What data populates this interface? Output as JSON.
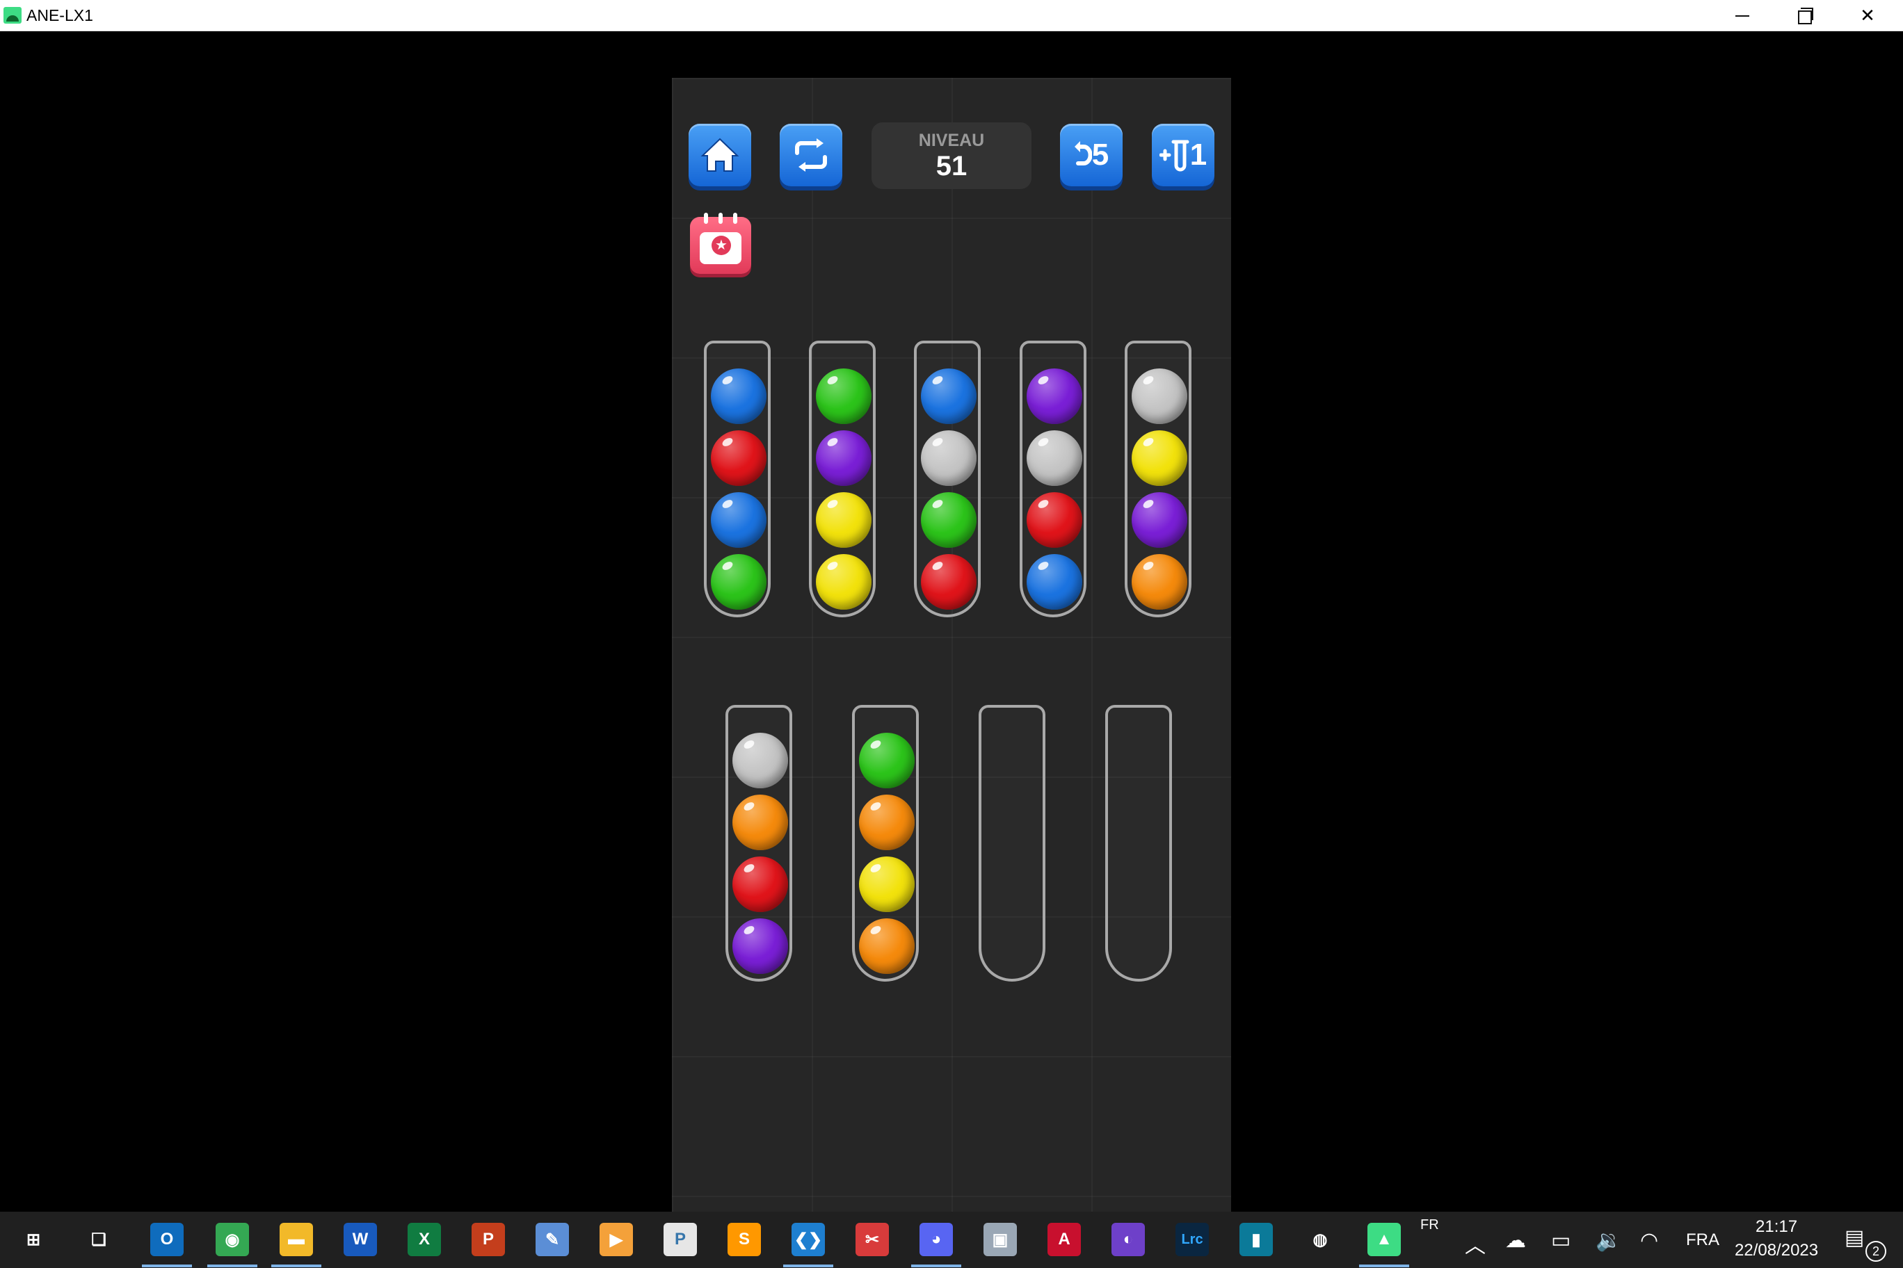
{
  "window": {
    "title": "ANE-LX1",
    "icon": "android-icon",
    "controls": [
      "minimize-icon",
      "restore-icon",
      "close-icon"
    ]
  },
  "game": {
    "level_label": "NIVEAU",
    "level_number": "51",
    "undo_count": "5",
    "add_tube_count": "1",
    "buttons": [
      "home-icon",
      "restart-icon",
      "undo-icon",
      "add-tube-icon",
      "daily-challenge-calendar-icon"
    ],
    "colors": {
      "blue": "#1b73e0",
      "red": "#e0141a",
      "green": "#2cc41a",
      "purple": "#7a1fd6",
      "yellow": "#f2e20c",
      "gray": "#c4c4c4",
      "orange": "#f58a0c"
    },
    "tubes": [
      {
        "row": 1,
        "balls_top_to_bottom": [
          "blue",
          "red",
          "blue",
          "green"
        ]
      },
      {
        "row": 1,
        "balls_top_to_bottom": [
          "green",
          "purple",
          "yellow",
          "yellow"
        ]
      },
      {
        "row": 1,
        "balls_top_to_bottom": [
          "blue",
          "gray",
          "green",
          "red"
        ]
      },
      {
        "row": 1,
        "balls_top_to_bottom": [
          "purple",
          "gray",
          "red",
          "blue"
        ]
      },
      {
        "row": 1,
        "balls_top_to_bottom": [
          "gray",
          "yellow",
          "purple",
          "orange"
        ]
      },
      {
        "row": 2,
        "balls_top_to_bottom": [
          "gray",
          "orange",
          "red",
          "purple"
        ]
      },
      {
        "row": 2,
        "balls_top_to_bottom": [
          "green",
          "orange",
          "yellow",
          "orange"
        ]
      },
      {
        "row": 2,
        "balls_top_to_bottom": []
      },
      {
        "row": 2,
        "balls_top_to_bottom": []
      }
    ]
  },
  "taskbar": {
    "apps": [
      {
        "name": "start-icon",
        "glyph": "⊞"
      },
      {
        "name": "task-view-icon",
        "glyph": "❏"
      },
      {
        "name": "outlook-icon",
        "glyph": "O"
      },
      {
        "name": "chrome-icon",
        "glyph": "◉"
      },
      {
        "name": "file-explorer-icon",
        "glyph": "▬"
      },
      {
        "name": "word-icon",
        "glyph": "W"
      },
      {
        "name": "excel-icon",
        "glyph": "X"
      },
      {
        "name": "powerpoint-icon",
        "glyph": "P"
      },
      {
        "name": "image-editor-icon",
        "glyph": "✎"
      },
      {
        "name": "media-player-icon",
        "glyph": "▶"
      },
      {
        "name": "python-file-icon",
        "glyph": "P"
      },
      {
        "name": "sublime-text-icon",
        "glyph": "S"
      },
      {
        "name": "vscode-icon",
        "glyph": "❮❯"
      },
      {
        "name": "snipping-tool-icon",
        "glyph": "✂"
      },
      {
        "name": "discord-icon",
        "glyph": "◕"
      },
      {
        "name": "scanner-icon",
        "glyph": "▣"
      },
      {
        "name": "acrobat-icon",
        "glyph": "A"
      },
      {
        "name": "github-desktop-icon",
        "glyph": "◐"
      },
      {
        "name": "lightroom-classic-icon",
        "glyph": "Lrc"
      },
      {
        "name": "teal-app-icon",
        "glyph": "▮"
      },
      {
        "name": "obs-icon",
        "glyph": "◍"
      },
      {
        "name": "android-app-icon",
        "glyph": "▲"
      }
    ],
    "input_lang_top": "FR",
    "input_lang": "FRA",
    "time": "21:17",
    "date": "22/08/2023",
    "notification_count": "2"
  }
}
